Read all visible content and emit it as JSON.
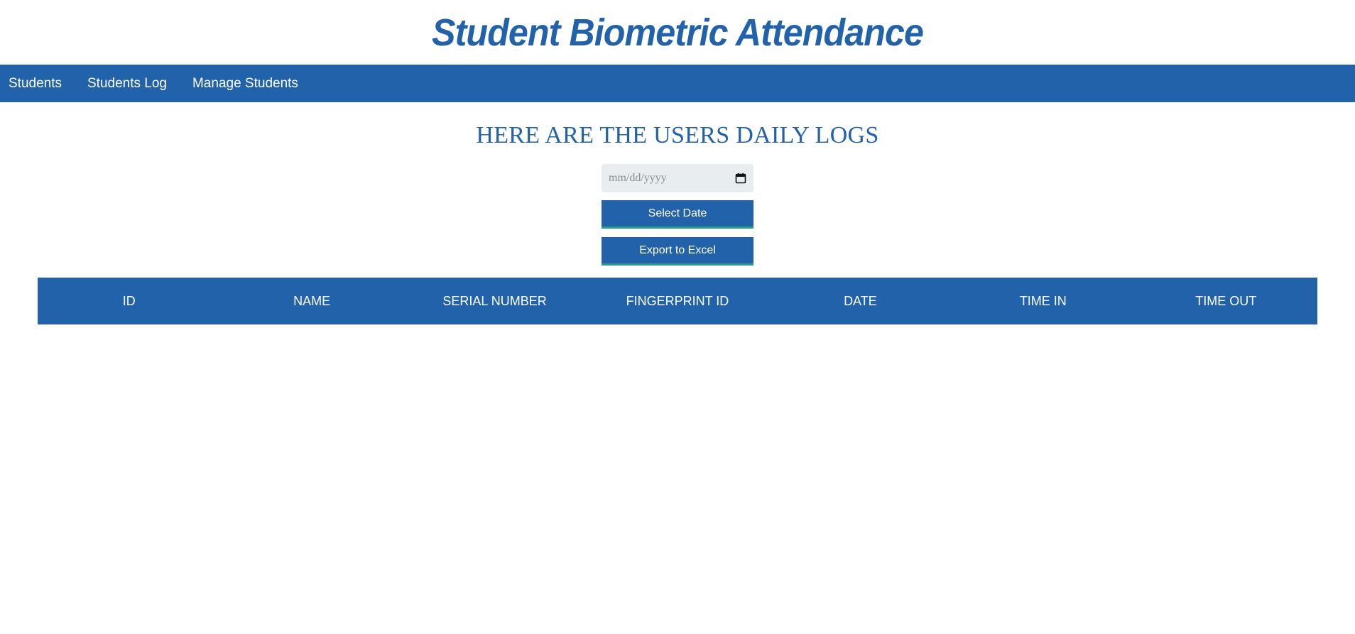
{
  "app_title": "Student Biometric Attendance",
  "nav": {
    "items": [
      {
        "label": "Students"
      },
      {
        "label": "Students Log"
      },
      {
        "label": "Manage Students"
      }
    ]
  },
  "main": {
    "heading": "HERE ARE THE USERS DAILY LOGS",
    "date_field": {
      "placeholder": "mm/dd/yyyy",
      "value": ""
    },
    "select_date_label": "Select Date",
    "export_label": "Export to Excel"
  },
  "table": {
    "columns": [
      "ID",
      "NAME",
      "SERIAL NUMBER",
      "FINGERPRINT ID",
      "DATE",
      "TIME IN",
      "TIME OUT"
    ],
    "rows": []
  },
  "colors": {
    "primary": "#2162ab",
    "button_underline": "#2e9a8e",
    "date_field_bg": "#e8edf0"
  },
  "icons": {
    "date_picker": "calendar-icon"
  }
}
